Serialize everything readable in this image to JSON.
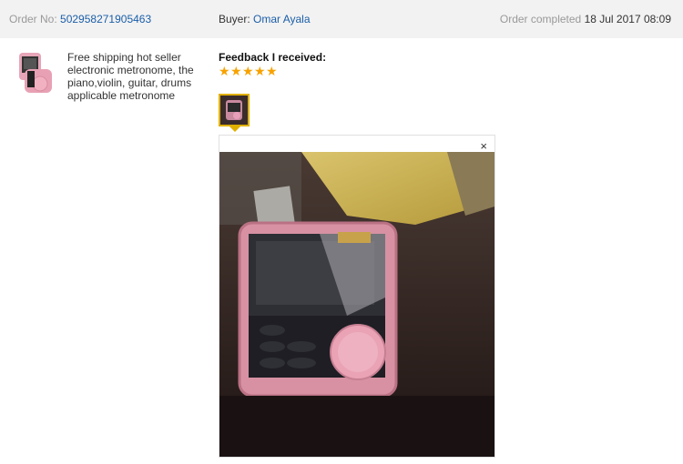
{
  "order": {
    "label": "Order No:",
    "number": "502958271905463",
    "buyer_label": "Buyer:",
    "buyer_name": "Omar Ayala",
    "status_label": "Order completed",
    "status_date": "18 Jul 2017 08:09"
  },
  "product": {
    "title": "Free shipping hot seller electronic metronome, the piano,violin, guitar, drums applicable metronome",
    "thumb_icon": "pink-metronome-image"
  },
  "feedback": {
    "label": "Feedback I received:",
    "stars": [
      "★",
      "★",
      "★",
      "★",
      "★"
    ],
    "rating": 5,
    "star_color": "#f7a200"
  },
  "preview": {
    "close_glyph": "×",
    "icon": "metronome-photo"
  }
}
